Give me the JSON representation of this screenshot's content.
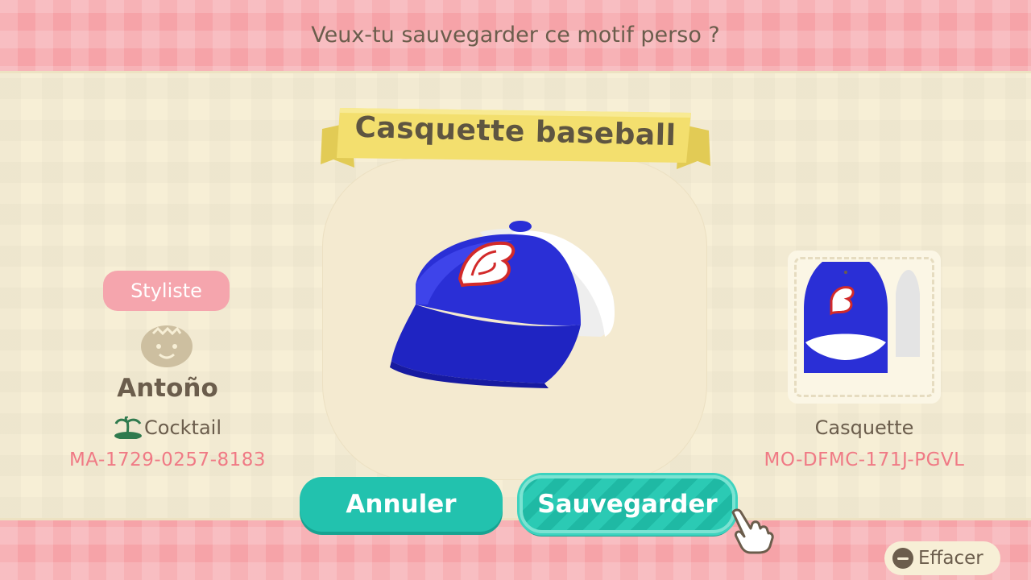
{
  "dialog": {
    "question": "Veux-tu sauvegarder ce motif perso ?"
  },
  "pattern": {
    "title": "Casquette baseball",
    "type": "Casquette",
    "design_code": "MO-DFMC-171J-PGVL",
    "cap_letter": "B"
  },
  "creator": {
    "badge": "Styliste",
    "name": "Antoño",
    "island": "Cocktail",
    "creator_code": "MA-1729-0257-8183"
  },
  "buttons": {
    "cancel": "Annuler",
    "save": "Sauvegarder"
  },
  "controls": {
    "erase": "Effacer"
  },
  "icons": {
    "avatar": "villager-face-icon",
    "island": "palm-island-icon",
    "cursor": "pointing-hand-icon",
    "erase": "minus-button-icon"
  },
  "colors": {
    "background": "#f6a3a8",
    "panel": "#f7efd6",
    "banner": "#f3df6e",
    "teal_button": "#22c2ae",
    "code_text": "#f07a85",
    "cap_blue": "#2a2fd6"
  }
}
